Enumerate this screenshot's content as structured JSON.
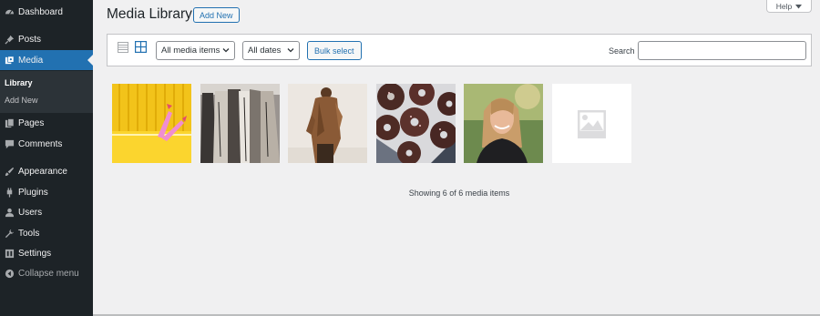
{
  "sidebar": {
    "items": [
      {
        "label": "Dashboard",
        "icon": "dashboard-icon"
      },
      {
        "label": "Posts",
        "icon": "pin-icon"
      },
      {
        "label": "Media",
        "icon": "media-icon"
      },
      {
        "label": "Pages",
        "icon": "pages-icon"
      },
      {
        "label": "Comments",
        "icon": "comments-icon"
      },
      {
        "label": "Appearance",
        "icon": "brush-icon"
      },
      {
        "label": "Plugins",
        "icon": "plugin-icon"
      },
      {
        "label": "Users",
        "icon": "users-icon"
      },
      {
        "label": "Tools",
        "icon": "wrench-icon"
      },
      {
        "label": "Settings",
        "icon": "settings-icon"
      },
      {
        "label": "Collapse menu",
        "icon": "collapse-icon"
      }
    ],
    "submenu": [
      {
        "label": "Library"
      },
      {
        "label": "Add New"
      }
    ]
  },
  "header": {
    "title": "Media Library",
    "add_new": "Add New",
    "help": "Help"
  },
  "toolbar": {
    "filter_type": "All media items",
    "filter_date": "All dates",
    "bulk_select": "Bulk select",
    "search_label": "Search",
    "search_value": ""
  },
  "media": {
    "items": [
      {
        "name": "yellow-bathtub-legs"
      },
      {
        "name": "hanging-coats"
      },
      {
        "name": "woman-brown-coat"
      },
      {
        "name": "chocolate-donuts"
      },
      {
        "name": "smiling-woman-portrait"
      },
      {
        "name": "image-placeholder"
      }
    ],
    "status": "Showing 6 of 6 media items"
  },
  "colors": {
    "sidebar_bg": "#1d2327",
    "accent": "#2271b1",
    "page_bg": "#f0f0f1"
  }
}
